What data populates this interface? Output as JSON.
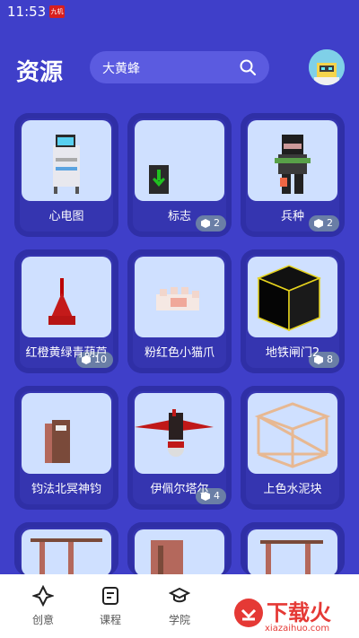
{
  "status": {
    "time": "11:53",
    "notif": "九机"
  },
  "header": {
    "title": "资源",
    "search_value": "大黄蜂"
  },
  "items": [
    {
      "label": "心电图"
    },
    {
      "label": "标志",
      "count": "2"
    },
    {
      "label": "兵种",
      "count": "2"
    },
    {
      "label": "红橙黄绿青葫芦",
      "count": "10"
    },
    {
      "label": "粉红色小猫爪"
    },
    {
      "label": "地铁闸门2",
      "count": "8"
    },
    {
      "label": "钧法北冥神钧"
    },
    {
      "label": "伊佩尔塔尔",
      "count": "4"
    },
    {
      "label": "上色水泥块"
    }
  ],
  "tabs": [
    {
      "label": "创意"
    },
    {
      "label": "课程"
    },
    {
      "label": "学院"
    }
  ],
  "watermark": {
    "main": "下载火",
    "sub": "xiazaihuo.com"
  }
}
